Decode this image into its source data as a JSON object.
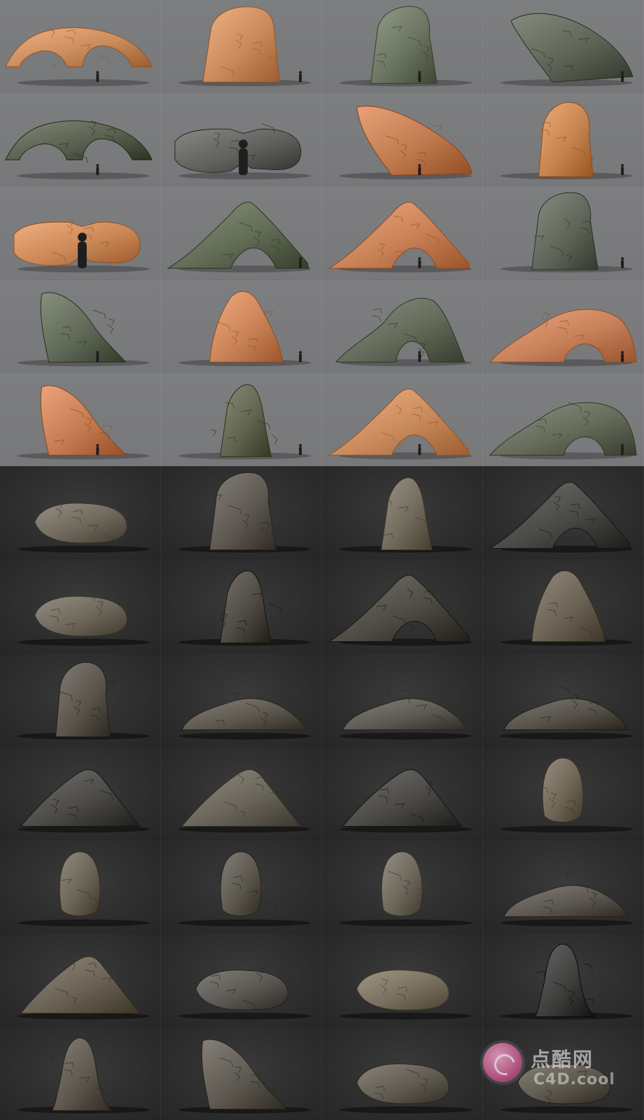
{
  "gallery": {
    "top_rocks": [
      {
        "shape": "arch-low",
        "color": "#c98a5c",
        "silhouette": true
      },
      {
        "shape": "block-tall",
        "color": "#c98a5c",
        "silhouette": true
      },
      {
        "shape": "tower",
        "color": "#6b7461",
        "silhouette": true
      },
      {
        "shape": "slab-leaning",
        "color": "#5d6356",
        "silhouette": true
      },
      {
        "shape": "arch-low",
        "color": "#59604f",
        "silhouette": true
      },
      {
        "shape": "split-boulder",
        "color": "#5f5f5c",
        "silhouette": true
      },
      {
        "shape": "slab-wedge",
        "color": "#c07a4f",
        "silhouette": true
      },
      {
        "shape": "pillar",
        "color": "#c5834f",
        "silhouette": true
      },
      {
        "shape": "split-boulder",
        "color": "#c98757",
        "silhouette": true
      },
      {
        "shape": "arch-peak",
        "color": "#626c56",
        "silhouette": true
      },
      {
        "shape": "arch-peak",
        "color": "#c98257",
        "silhouette": true
      },
      {
        "shape": "tower",
        "color": "#5f665a",
        "silhouette": true
      },
      {
        "shape": "spire-lean",
        "color": "#5f6756",
        "silhouette": true
      },
      {
        "shape": "mound-tall",
        "color": "#c98357",
        "silhouette": true
      },
      {
        "shape": "arch-dome",
        "color": "#646b5b",
        "silhouette": true
      },
      {
        "shape": "arch-wide",
        "color": "#c7815a",
        "silhouette": true
      },
      {
        "shape": "spire-lean",
        "color": "#c47b52",
        "silhouette": true
      },
      {
        "shape": "spire",
        "color": "#616550",
        "silhouette": true
      },
      {
        "shape": "arch-peak",
        "color": "#c98b5c",
        "silhouette": true
      },
      {
        "shape": "arch-wide",
        "color": "#666b5b",
        "silhouette": true
      }
    ],
    "bottom_rocks": [
      {
        "shape": "boulder-flat",
        "color": "#6e685c"
      },
      {
        "shape": "tower",
        "color": "#5d5851"
      },
      {
        "shape": "spire",
        "color": "#726b5c"
      },
      {
        "shape": "arch-peak",
        "color": "#4b4a47"
      },
      {
        "shape": "boulder-flat",
        "color": "#6d675b"
      },
      {
        "shape": "spire",
        "color": "#4e4a43"
      },
      {
        "shape": "arch-peak",
        "color": "#4f4b45"
      },
      {
        "shape": "mound-tall",
        "color": "#6a6253"
      },
      {
        "shape": "pillar",
        "color": "#5a554d"
      },
      {
        "shape": "rubble",
        "color": "#5e5950"
      },
      {
        "shape": "rubble",
        "color": "#5d5a53"
      },
      {
        "shape": "rubble",
        "color": "#56524a"
      },
      {
        "shape": "mound",
        "color": "#4d4b47"
      },
      {
        "shape": "mound",
        "color": "#6a655a"
      },
      {
        "shape": "mound",
        "color": "#4c4a46"
      },
      {
        "shape": "pillar-float",
        "color": "#6f6657"
      },
      {
        "shape": "pillar-float",
        "color": "#6a6356"
      },
      {
        "shape": "pillar-float",
        "color": "#5c5850"
      },
      {
        "shape": "pillar-float",
        "color": "#6d685c"
      },
      {
        "shape": "rubble",
        "color": "#5c5851"
      },
      {
        "shape": "mound",
        "color": "#6a6254"
      },
      {
        "shape": "boulder-flat",
        "color": "#5a5752"
      },
      {
        "shape": "boulder-flat",
        "color": "#786f5e"
      },
      {
        "shape": "standing-stone",
        "color": "#3f3f3d"
      },
      {
        "shape": "standing-stone",
        "color": "#5d574e"
      },
      {
        "shape": "spire-lean",
        "color": "#5c5850"
      },
      {
        "shape": "boulder-flat",
        "color": "#615c52"
      },
      {
        "shape": "boulder-flat",
        "color": "#5c574c"
      }
    ]
  },
  "watermark": {
    "line1": "点酷网",
    "line2": "C4D.cool"
  }
}
